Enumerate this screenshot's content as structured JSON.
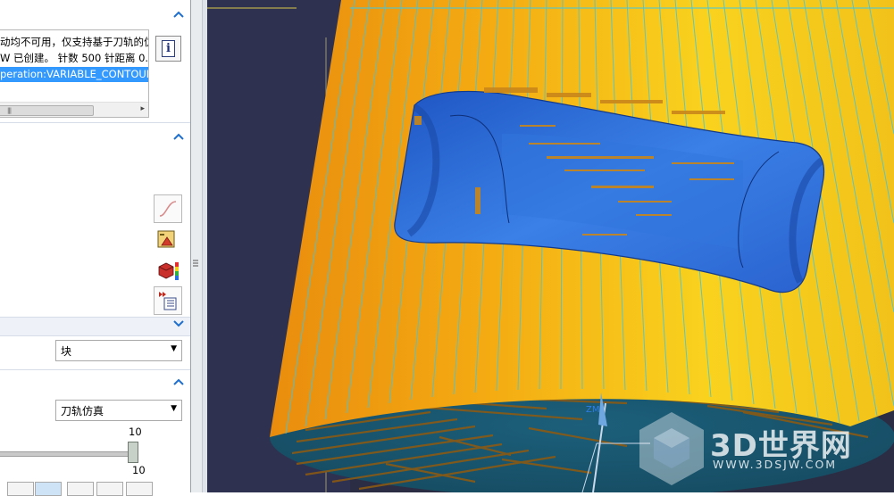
{
  "dialog": {
    "messages": [
      "动均不可用，仅支持基于刀轨的仿",
      "W 已创建。 针数 500 针距离 0.",
      "peration:VARIABLE_CONTOUR"
    ],
    "blank_select_value": "块",
    "display_select_value": "刀轨仿真",
    "speed_slider": {
      "max_label": "10",
      "value_label": "10",
      "value_fraction": 1.0
    }
  },
  "viewport": {
    "axis_label": "ZM",
    "watermark_text": "3D世界网",
    "watermark_url": "WWW.3DSJW.COM"
  },
  "colors": {
    "part_gold": "#f2a91a",
    "pocket_blue": "#2f6fd6",
    "residual_brown": "#8b5a14",
    "toolpath_cyan": "#3fc6e6",
    "background_dark": "#2a2d44",
    "accent_blue": "#1f6fd1"
  },
  "icons": [
    "chevron-up-icon",
    "info-icon",
    "curve-icon",
    "material-icon",
    "color-map-icon",
    "step-list-icon",
    "chevron-down-icon",
    "dropdown-arrow-icon"
  ]
}
